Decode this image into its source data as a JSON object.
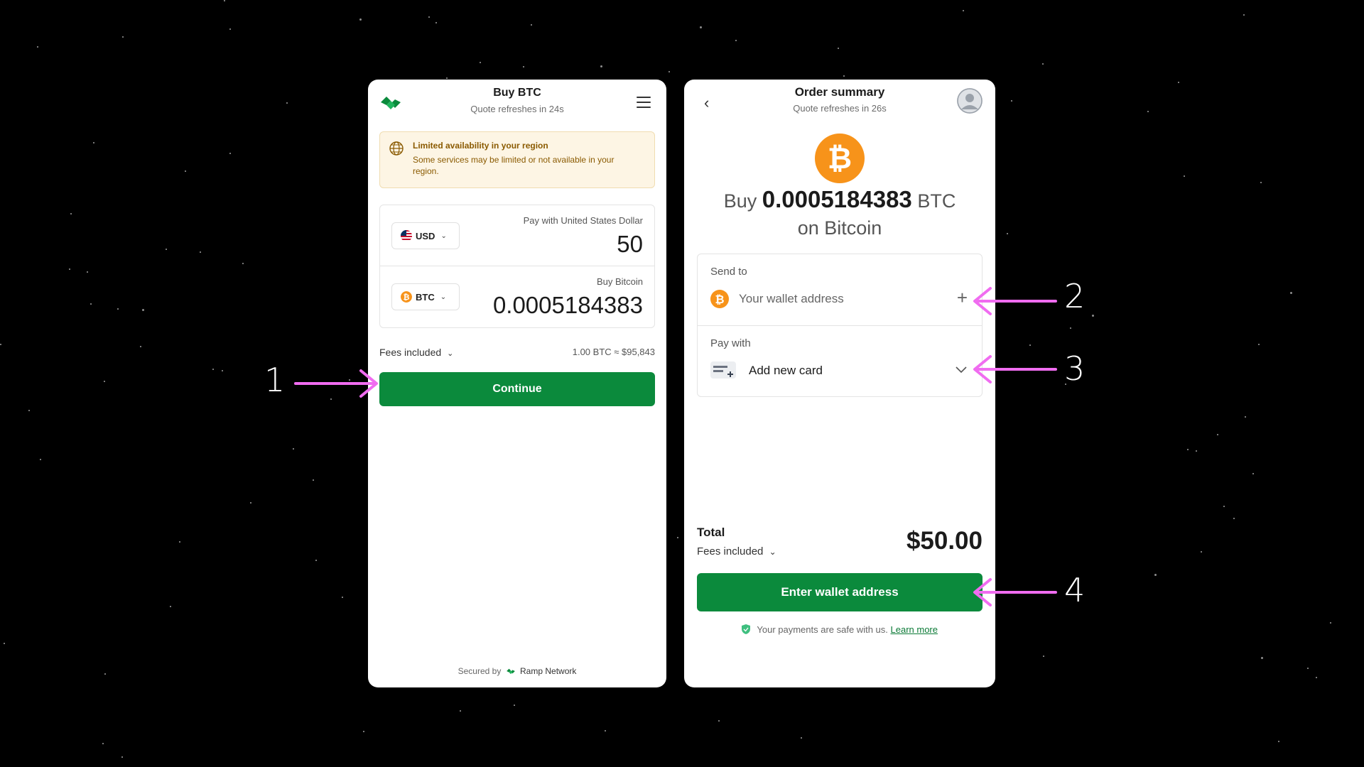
{
  "left_panel": {
    "title": "Buy BTC",
    "subtitle": "Quote refreshes in 24s",
    "notice": {
      "title": "Limited availability in your region",
      "body": "Some services may be limited or not available in your region."
    },
    "pay": {
      "currency": "USD",
      "caption": "Pay with United States Dollar",
      "amount": "50"
    },
    "buy": {
      "currency": "BTC",
      "caption": "Buy Bitcoin",
      "amount": "0.0005184383"
    },
    "fees_label": "Fees included",
    "rate": "1.00 BTC ≈ $95,843",
    "continue_label": "Continue",
    "secured_prefix": "Secured by",
    "secured_brand": "Ramp Network"
  },
  "right_panel": {
    "title": "Order summary",
    "subtitle": "Quote refreshes in 26s",
    "buy_prefix": "Buy",
    "buy_amount": "0.0005184383",
    "buy_unit": "BTC",
    "network_line": "on Bitcoin",
    "send_to_label": "Send to",
    "wallet_placeholder": "Your wallet address",
    "pay_with_label": "Pay with",
    "card_text": "Add new card",
    "total_label": "Total",
    "fees_label": "Fees included",
    "total_amount": "$50.00",
    "enter_wallet_label": "Enter wallet address",
    "safe_text": "Your payments are safe with us.",
    "learn_more": "Learn more"
  },
  "annotations": [
    "1",
    "2",
    "3",
    "4"
  ],
  "colors": {
    "brand_green": "#0b8a3c",
    "bitcoin_orange": "#f7931a",
    "annotation_pink": "#f06cf0",
    "notice_bg": "#fdf5e4"
  },
  "icons": [
    "ramp-logo-icon",
    "menu-icon",
    "globe-icon",
    "us-flag-icon",
    "bitcoin-icon",
    "back-arrow-icon",
    "avatar-icon",
    "plus-icon",
    "card-icon",
    "chevron-down-icon",
    "shield-icon"
  ]
}
